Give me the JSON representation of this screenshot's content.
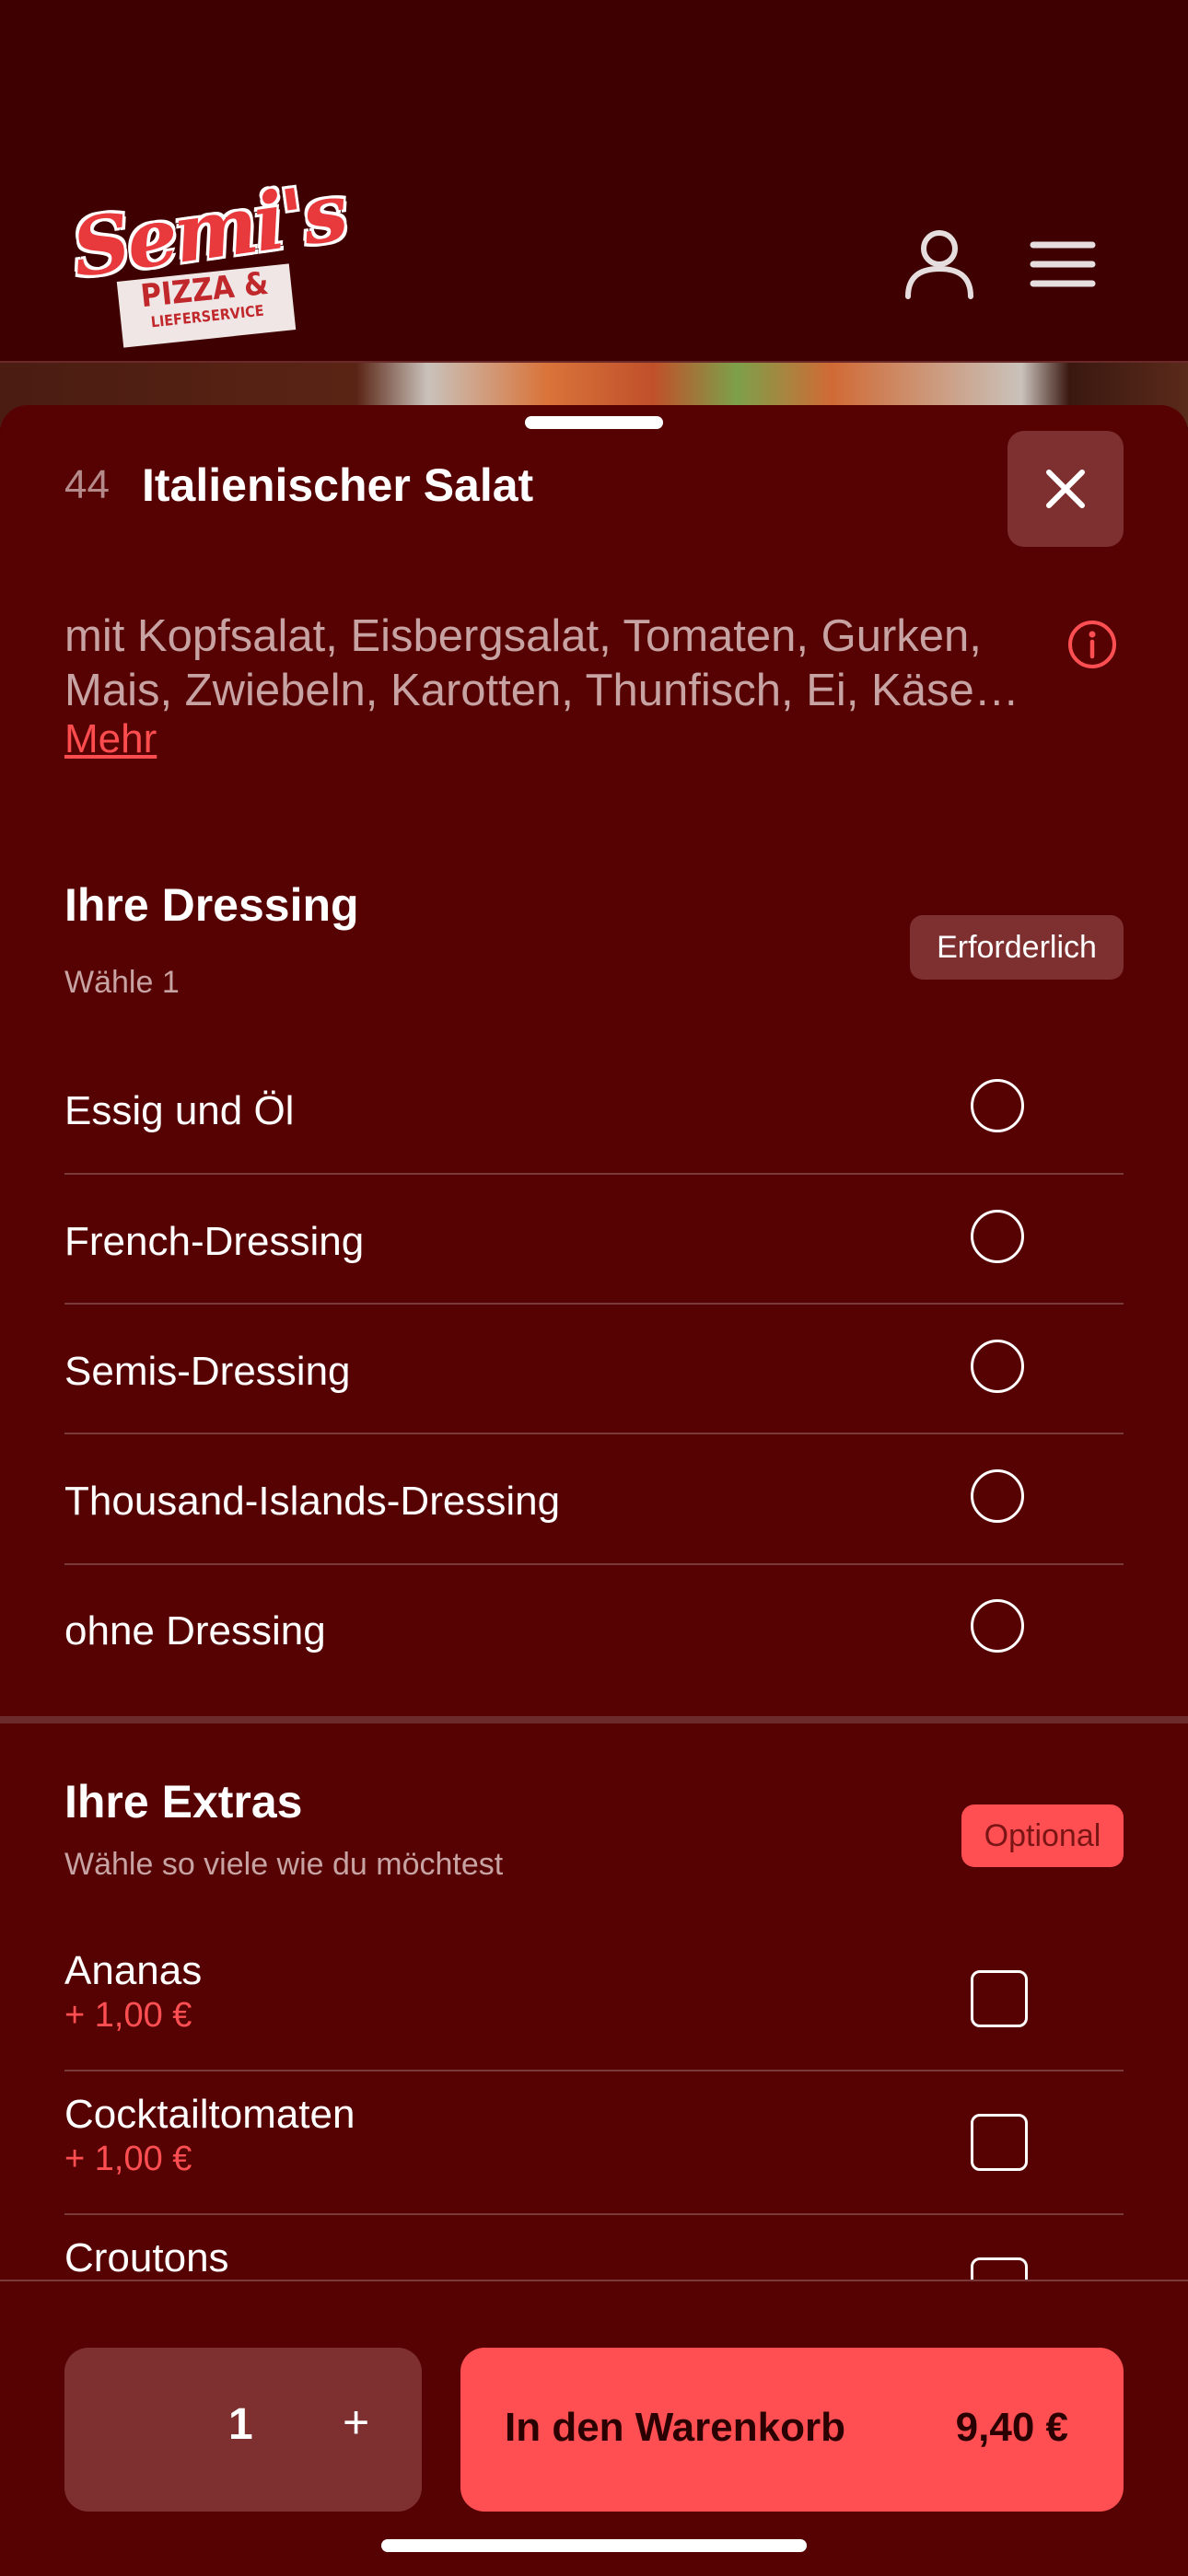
{
  "header": {
    "logo_script": "Semi's",
    "logo_line1": "PIZZA &",
    "logo_line2": "LIEFERSERVICE",
    "user_icon": "user-icon",
    "menu_icon": "hamburger-menu-icon"
  },
  "item": {
    "number": "44",
    "title": "Italienischer Salat",
    "description": "mit Kopfsalat, Eisbergsalat, Tomaten, Gurken, Mais, Zwiebeln, Karotten, Thunfisch, Ei, Käse…",
    "more_label": "Mehr",
    "info_icon": "info-icon",
    "close_icon": "close-icon"
  },
  "dressing": {
    "title": "Ihre Dressing",
    "subtitle": "Wähle 1",
    "badge": "Erforderlich",
    "options": [
      {
        "label": "Essig und Öl"
      },
      {
        "label": "French-Dressing"
      },
      {
        "label": "Semis-Dressing"
      },
      {
        "label": "Thousand-Islands-Dressing"
      },
      {
        "label": "ohne Dressing"
      }
    ]
  },
  "extras": {
    "title": "Ihre Extras",
    "subtitle": "Wähle so viele wie du möchtest",
    "badge": "Optional",
    "options": [
      {
        "label": "Ananas",
        "price": "+ 1,00 €"
      },
      {
        "label": "Cocktailtomaten",
        "price": "+ 1,00 €"
      },
      {
        "label": "Croutons"
      }
    ]
  },
  "footer": {
    "quantity": "1",
    "plus_label": "+",
    "cart_label": "In den Warenkorb",
    "cart_price": "9,40 €"
  },
  "colors": {
    "accent": "#ff4f52",
    "sheet_bg": "#570202",
    "header_bg": "#3e0000",
    "muted_button": "#7e3030"
  }
}
